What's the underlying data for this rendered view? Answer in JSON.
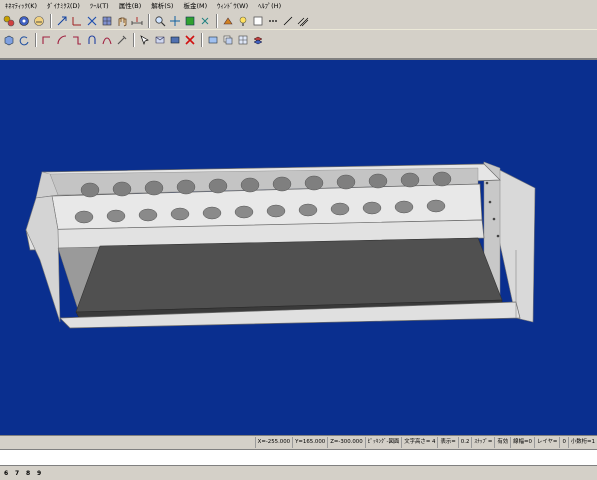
{
  "menu": [
    "ｷﾈﾏﾃｨｯｸ(K)",
    "ﾀﾞｲﾅﾐｸｽ(D)",
    "ﾂｰﾙ(T)",
    "属性(B)",
    "解析(S)",
    "板金(M)",
    "ｳｨﾝﾄﾞｳ(W)",
    "ﾍﾙﾌﾟ(H)"
  ],
  "toolbar_icons": {
    "row1": [
      "gears-icon",
      "wheel-icon",
      "face-icon",
      "vector-icon",
      "axis-icon",
      "cross-icon",
      "grid-icon",
      "hand-icon",
      "dimension-icon",
      "zoom-icon",
      "move-icon",
      "fit-icon",
      "pan-icon",
      "render-icon",
      "light-icon",
      "box-icon",
      "dots-icon",
      "line-icon",
      "hatch-icon"
    ],
    "row2": [
      "cube-icon",
      "rotate-icon",
      "corner-icon",
      "arc-icon",
      "bend-icon",
      "loop-icon",
      "curve-icon",
      "tool-icon",
      "pointer-icon",
      "fold-icon",
      "tag-icon",
      "delete-icon",
      "sheet-icon",
      "stack-icon",
      "grid2-icon",
      "layers-icon"
    ]
  },
  "status": [
    "X=-255.000",
    "Y=165.000",
    "Z=-300.000",
    "ﾋﾟｯｷﾝｸﾞ-図面",
    "文字高さ= 4",
    "表示=",
    "0.2",
    "ｽﾅｯﾌﾟ=",
    "有効",
    "線幅=0",
    "レイヤ=",
    "0",
    "小数桁=1"
  ],
  "bottom_numbers": [
    "6",
    "7",
    "8",
    "9"
  ],
  "colors": {
    "viewport_bg": "#0a2f8f",
    "panel": "#d4d0c8",
    "model_face": "#e6e6e6",
    "model_inner": "#9a9a9a",
    "plate": "#505050"
  }
}
